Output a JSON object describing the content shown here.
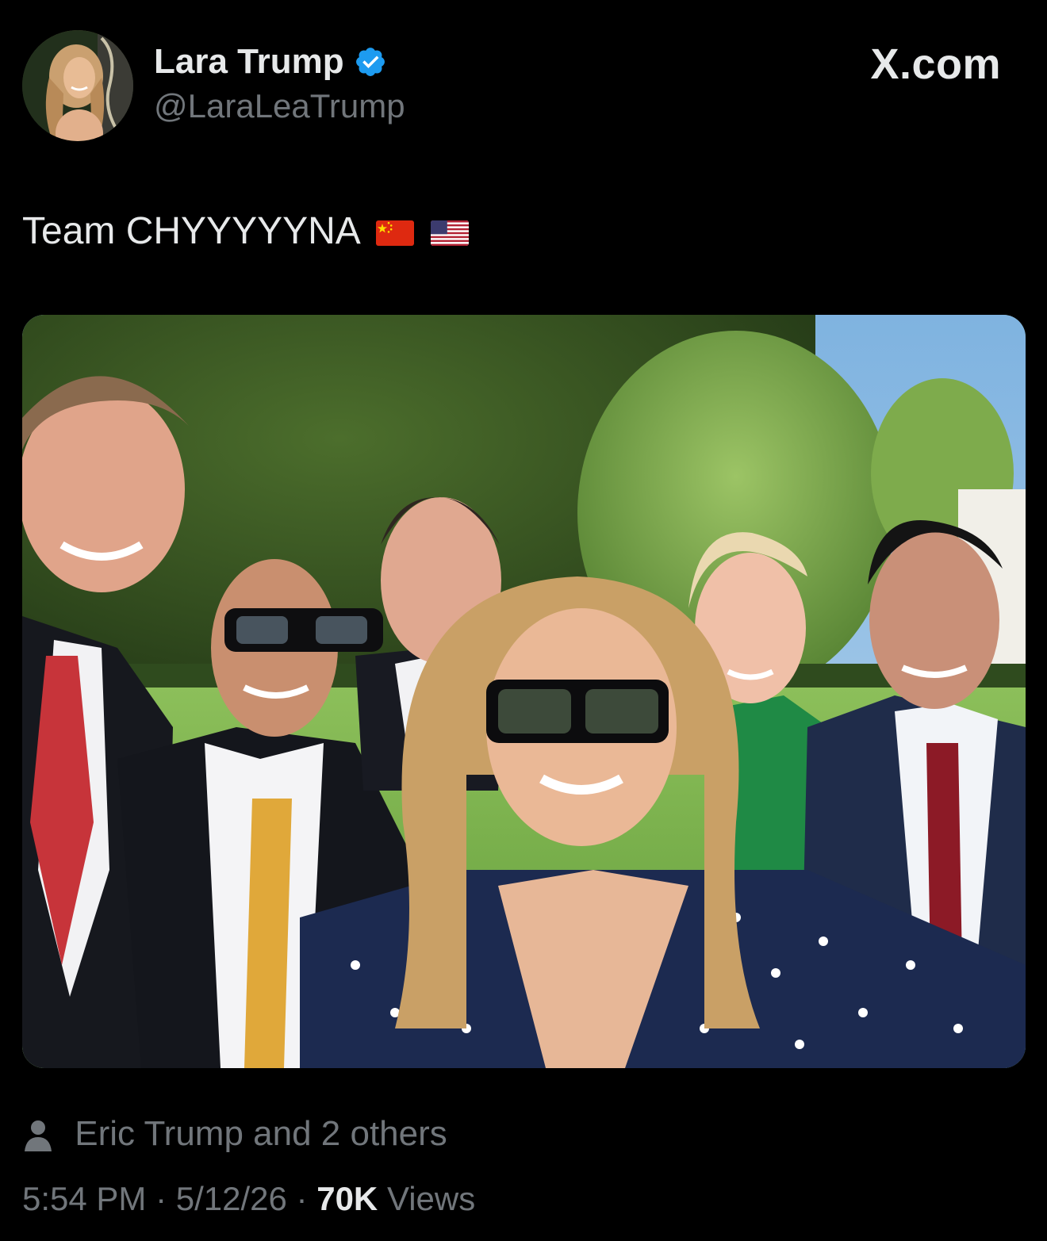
{
  "author": {
    "display_name": "Lara Trump",
    "handle": "@LaraLeaTrump",
    "verified": true,
    "verified_color": "#1d9bf0",
    "avatar_icon": "profile-photo"
  },
  "site": {
    "label": "X.com"
  },
  "tweet": {
    "text": "Team CHYYYYYNA",
    "emojis": [
      "flag-china",
      "flag-usa"
    ]
  },
  "media": {
    "type": "photo",
    "icon": "group-selfie-photo"
  },
  "engagement": {
    "icon": "person-icon",
    "text": "Eric Trump and 2 others"
  },
  "meta": {
    "time": "5:54 PM",
    "separator": " · ",
    "date": "5/12/26",
    "views_count": "70K",
    "views_label": "Views"
  },
  "colors": {
    "background": "#000000",
    "primary_text": "#e7e9ea",
    "secondary_text": "#71767b"
  }
}
